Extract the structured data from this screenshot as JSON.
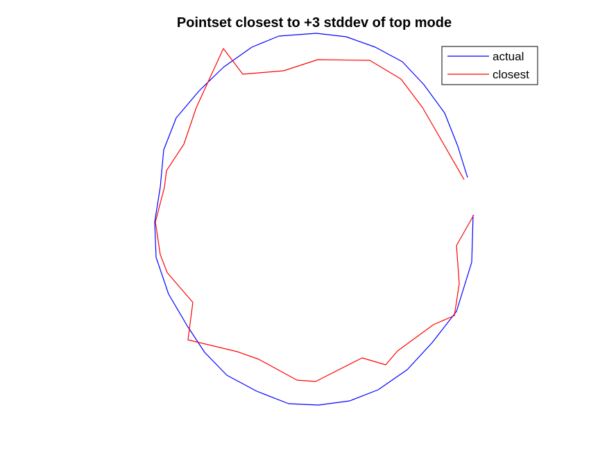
{
  "chart_data": {
    "type": "line",
    "title": "Pointset closest to +3 stddev of top mode",
    "xlabel": "",
    "ylabel": "",
    "axes_visible": false,
    "legend": {
      "placement": "top-right",
      "entries": [
        "actual",
        "closest"
      ]
    },
    "series": [
      {
        "name": "actual",
        "color": "#0000ff",
        "x": [
          674,
          660,
          641,
          611,
          580,
          541,
          499,
          456,
          402,
          363,
          322,
          287,
          254,
          236,
          231,
          223,
          225,
          243,
          270,
          295,
          327,
          370,
          416,
          459,
          504,
          545,
          587,
          623,
          658,
          680,
          682
        ],
        "y": [
          256,
          211,
          163,
          122,
          89,
          68,
          53,
          48,
          52,
          68,
          97,
          131,
          170,
          216,
          270,
          320,
          371,
          424,
          470,
          508,
          541,
          564,
          582,
          584,
          578,
          562,
          533,
          494,
          449,
          378,
          310
        ]
      },
      {
        "name": "closest",
        "color": "#ff0000",
        "x": [
          669,
          627,
          609,
          578,
          533,
          458,
          409,
          350,
          322,
          283,
          265,
          240,
          237,
          224,
          231,
          241,
          278,
          271,
          342,
          373,
          428,
          455,
          522,
          556,
          573,
          625,
          655,
          662,
          658,
          683
        ],
        "y": [
          259,
          186,
          155,
          114,
          87,
          86,
          102,
          107,
          70,
          155,
          208,
          246,
          270,
          320,
          367,
          393,
          436,
          490,
          507,
          518,
          548,
          550,
          516,
          526,
          506,
          468,
          455,
          409,
          354,
          310
        ]
      }
    ]
  }
}
